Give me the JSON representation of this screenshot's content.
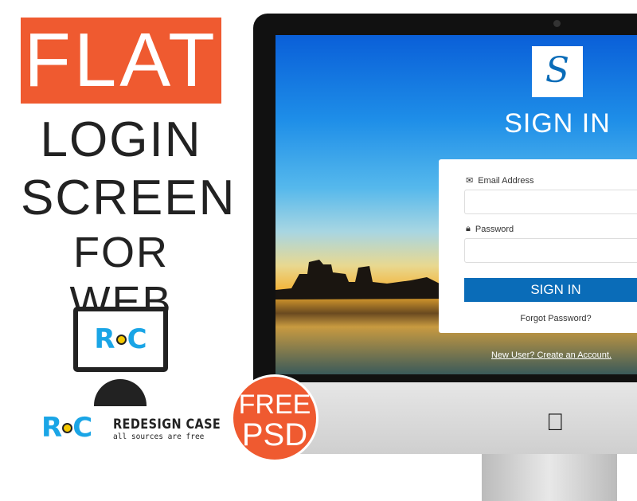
{
  "headline": {
    "line1": "FLAT",
    "line2": "LOGIN",
    "line3": "SCREEN",
    "line4": "FOR WEB"
  },
  "brand": {
    "logo_text": "RC",
    "name": "REDESIGN CASE",
    "tagline": "all sources are free"
  },
  "badge": {
    "line1": "FREE",
    "line2": "PSD"
  },
  "login": {
    "logo_letter": "S",
    "title": "SIGN IN",
    "email_label": "Email Address",
    "password_label": "Password",
    "email_value": "",
    "password_value": "",
    "button_label": "SIGN IN",
    "forgot_link": "Forgot Password?",
    "create_link": "New User? Create an Account."
  },
  "colors": {
    "accent_orange": "#ef5a30",
    "button_blue": "#0a6cb8",
    "brand_blue": "#1aa5e6",
    "brand_yellow": "#f5c800"
  }
}
